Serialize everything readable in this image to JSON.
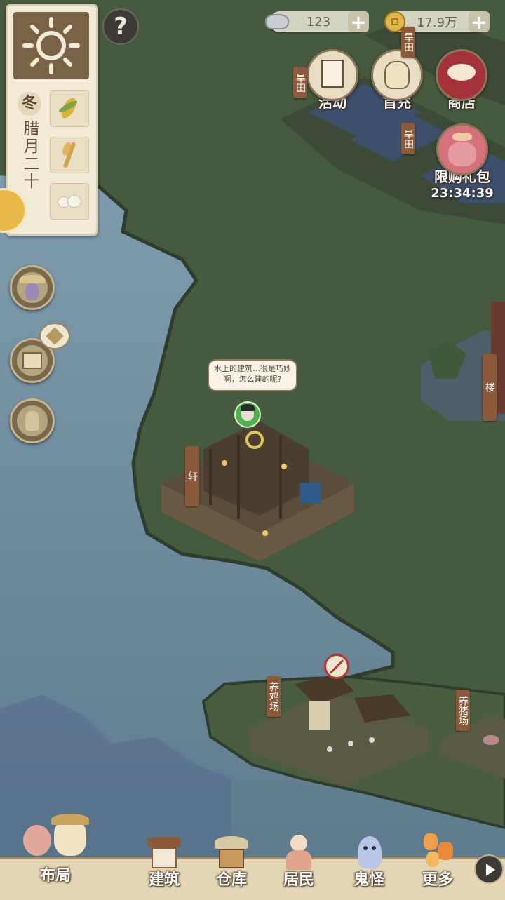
{
  "resources": {
    "silver": {
      "icon": "silver-ingot-icon",
      "value": "123"
    },
    "coins": {
      "icon": "copper-coin-icon",
      "value": "17.9万"
    }
  },
  "help_icon": "help-icon",
  "calendar": {
    "season": "冬",
    "date": "腊月二十",
    "crops": [
      "corn-icon",
      "wheat-icon",
      "cotton-icon"
    ]
  },
  "side_buttons": [
    "farmer-icon",
    "book-icon",
    "bundle-icon"
  ],
  "top_menu": [
    {
      "label": "活动",
      "icon": "event-scroll-icon"
    },
    {
      "label": "首充",
      "icon": "first-recharge-bag-icon"
    },
    {
      "label": "商店",
      "icon": "shop-icon"
    }
  ],
  "limited_pack": {
    "label": "限购礼包",
    "timer": "23:34:39",
    "icon": "gift-bag-icon"
  },
  "plot_tags": {
    "drought_field_1": "旱田",
    "drought_field_2": "旱田",
    "drought_field_3": "旱田",
    "pavilion": "轩",
    "tower": "楼",
    "chicken_farm": "养鸡场",
    "pig_farm": "养猪场"
  },
  "speech_bubble": "水上的建筑…很是巧妙啊，怎么建的呢?",
  "bottom_nav": [
    {
      "label": "布局",
      "icon": "layout-icon"
    },
    {
      "label": "建筑",
      "icon": "building-icon"
    },
    {
      "label": "仓库",
      "icon": "warehouse-icon"
    },
    {
      "label": "居民",
      "icon": "resident-icon"
    },
    {
      "label": "鬼怪",
      "icon": "ghost-icon"
    },
    {
      "label": "更多",
      "icon": "lanterns-icon"
    }
  ],
  "colors": {
    "water": "#6f8ea2",
    "land": "#465a3f",
    "panel": "#f1ead7",
    "accent_brown": "#8a5a3a"
  }
}
